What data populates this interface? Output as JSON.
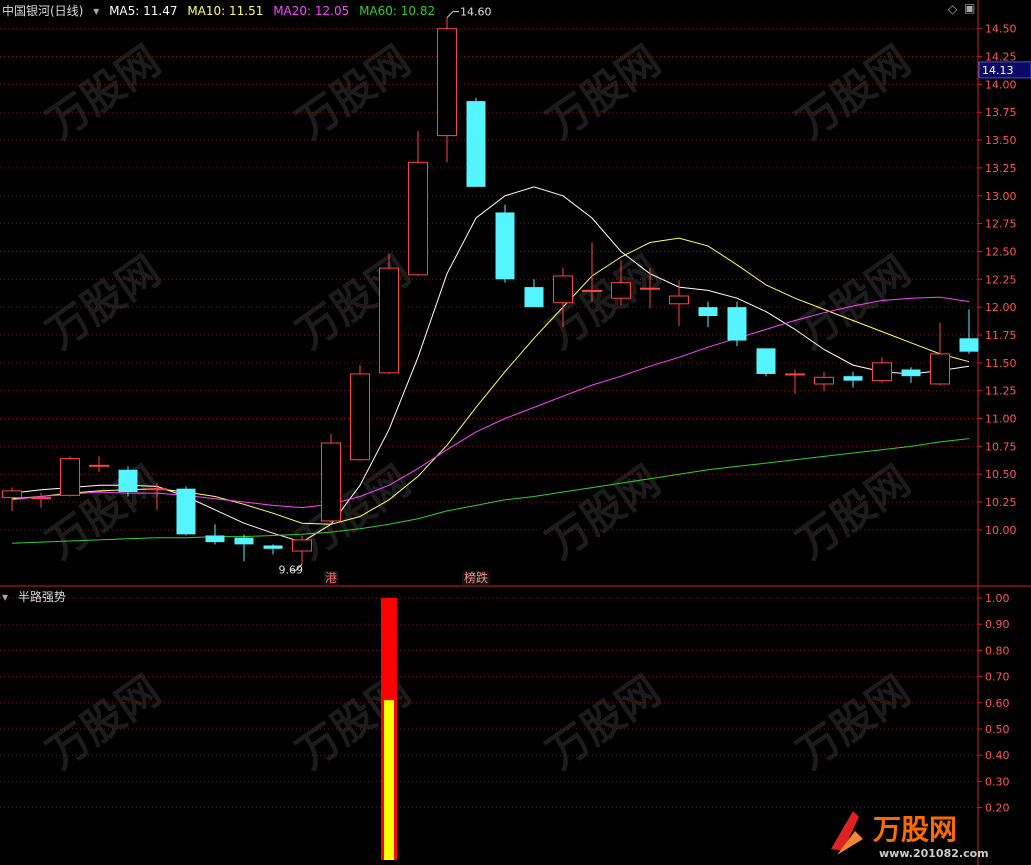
{
  "header": {
    "title": "中国银河(日线)",
    "ma_labels": [
      {
        "text": "MA5: 11.47",
        "color": "#ffffff"
      },
      {
        "text": "MA10: 11.51",
        "color": "#ffff66"
      },
      {
        "text": "MA20: 12.05",
        "color": "#ff44ff"
      },
      {
        "text": "MA60: 10.82",
        "color": "#33cc33"
      }
    ]
  },
  "indicator": {
    "title": "半路强势"
  },
  "colors": {
    "up": "#ff4444",
    "down": "#55f5ff",
    "grid": "#7a1a1a",
    "axis": "#cc2222",
    "ma5": "#ffffff",
    "ma10": "#ffff66",
    "ma20": "#ff44ff",
    "ma60": "#33cc33",
    "price_tag_bg": "#0a0a66"
  },
  "logo": {
    "text": "万股网",
    "url": "www.201082.com"
  },
  "chart_data": [
    {
      "type": "candlestick",
      "title": "中国银河(日线)",
      "ylim": [
        9.55,
        14.65
      ],
      "y_ticks": [
        "14.50",
        "14.25",
        "14.00",
        "13.75",
        "13.50",
        "13.25",
        "13.00",
        "12.75",
        "12.50",
        "12.25",
        "12.00",
        "11.75",
        "11.50",
        "11.25",
        "11.00",
        "10.75",
        "10.50",
        "10.25",
        "10.00"
      ],
      "current_price": "14.13",
      "annotations": {
        "high": "14.60",
        "low": "9.69",
        "events": [
          {
            "text": "港",
            "index": 11
          },
          {
            "text": "榜跌",
            "index": 16
          }
        ]
      },
      "candles": [
        {
          "o": 10.29,
          "c": 10.35,
          "h": 10.38,
          "l": 10.17
        },
        {
          "o": 10.29,
          "c": 10.29,
          "h": 10.33,
          "l": 10.2
        },
        {
          "o": 10.31,
          "c": 10.64,
          "h": 10.66,
          "l": 10.3
        },
        {
          "o": 10.58,
          "c": 10.58,
          "h": 10.66,
          "l": 10.52
        },
        {
          "o": 10.54,
          "c": 10.34,
          "h": 10.57,
          "l": 10.3
        },
        {
          "o": 10.37,
          "c": 10.37,
          "h": 10.42,
          "l": 10.18
        },
        {
          "o": 10.37,
          "c": 9.96,
          "h": 10.39,
          "l": 9.95
        },
        {
          "o": 9.95,
          "c": 9.89,
          "h": 10.05,
          "l": 9.87
        },
        {
          "o": 9.93,
          "c": 9.87,
          "h": 9.96,
          "l": 9.72
        },
        {
          "o": 9.86,
          "c": 9.83,
          "h": 9.87,
          "l": 9.78
        },
        {
          "o": 9.81,
          "c": 9.91,
          "h": 9.95,
          "l": 9.69
        },
        {
          "o": 10.08,
          "c": 10.78,
          "h": 10.86,
          "l": 10.06
        },
        {
          "o": 10.63,
          "c": 11.4,
          "h": 11.48,
          "l": 10.62
        },
        {
          "o": 11.41,
          "c": 12.35,
          "h": 12.48,
          "l": 11.4
        },
        {
          "o": 12.29,
          "c": 13.3,
          "h": 13.58,
          "l": 12.28
        },
        {
          "o": 13.54,
          "c": 14.5,
          "h": 14.6,
          "l": 13.3
        },
        {
          "o": 13.85,
          "c": 13.08,
          "h": 13.88,
          "l": 13.08
        },
        {
          "o": 12.85,
          "c": 12.25,
          "h": 12.92,
          "l": 12.22
        },
        {
          "o": 12.18,
          "c": 12.0,
          "h": 12.25,
          "l": 12.0
        },
        {
          "o": 12.04,
          "c": 12.28,
          "h": 12.35,
          "l": 11.82
        },
        {
          "o": 12.15,
          "c": 12.15,
          "h": 12.58,
          "l": 12.05
        },
        {
          "o": 12.08,
          "c": 12.22,
          "h": 12.42,
          "l": 12.02
        },
        {
          "o": 12.17,
          "c": 12.17,
          "h": 12.35,
          "l": 11.99
        },
        {
          "o": 12.03,
          "c": 12.1,
          "h": 12.24,
          "l": 11.83
        },
        {
          "o": 12.0,
          "c": 11.92,
          "h": 12.05,
          "l": 11.82
        },
        {
          "o": 12.0,
          "c": 11.7,
          "h": 12.05,
          "l": 11.65
        },
        {
          "o": 11.63,
          "c": 11.4,
          "h": 11.63,
          "l": 11.38
        },
        {
          "o": 11.4,
          "c": 11.4,
          "h": 11.44,
          "l": 11.22
        },
        {
          "o": 11.31,
          "c": 11.37,
          "h": 11.42,
          "l": 11.25
        },
        {
          "o": 11.38,
          "c": 11.34,
          "h": 11.42,
          "l": 11.28
        },
        {
          "o": 11.34,
          "c": 11.5,
          "h": 11.55,
          "l": 11.32
        },
        {
          "o": 11.44,
          "c": 11.38,
          "h": 11.46,
          "l": 11.32
        },
        {
          "o": 11.31,
          "c": 11.58,
          "h": 11.86,
          "l": 11.3
        },
        {
          "o": 11.72,
          "c": 11.6,
          "h": 11.98,
          "l": 11.58
        }
      ],
      "series": [
        {
          "name": "MA5",
          "values": [
            10.33,
            10.36,
            10.38,
            10.4,
            10.4,
            10.39,
            10.3,
            10.18,
            10.06,
            9.97,
            9.89,
            10.05,
            10.4,
            10.9,
            11.55,
            12.3,
            12.8,
            13.0,
            13.08,
            13.0,
            12.8,
            12.5,
            12.3,
            12.18,
            12.15,
            12.08,
            11.96,
            11.8,
            11.62,
            11.48,
            11.42,
            11.4,
            11.43,
            11.47
          ]
        },
        {
          "name": "MA10",
          "values": [
            10.28,
            10.3,
            10.33,
            10.35,
            10.36,
            10.37,
            10.34,
            10.3,
            10.23,
            10.15,
            10.06,
            10.05,
            10.12,
            10.27,
            10.48,
            10.76,
            11.1,
            11.42,
            11.72,
            12.0,
            12.28,
            12.45,
            12.58,
            12.62,
            12.55,
            12.38,
            12.2,
            12.08,
            11.98,
            11.88,
            11.78,
            11.68,
            11.58,
            11.51
          ]
        },
        {
          "name": "MA20",
          "values": [
            10.27,
            10.3,
            10.32,
            10.34,
            10.33,
            10.33,
            10.31,
            10.28,
            10.25,
            10.22,
            10.2,
            10.23,
            10.3,
            10.4,
            10.55,
            10.72,
            10.88,
            11.0,
            11.1,
            11.2,
            11.3,
            11.38,
            11.47,
            11.55,
            11.64,
            11.72,
            11.8,
            11.88,
            11.95,
            12.01,
            12.06,
            12.08,
            12.09,
            12.05
          ]
        },
        {
          "name": "MA60",
          "values": [
            9.88,
            9.89,
            9.9,
            9.91,
            9.92,
            9.93,
            9.93,
            9.94,
            9.94,
            9.95,
            9.96,
            9.98,
            10.01,
            10.05,
            10.1,
            10.17,
            10.22,
            10.27,
            10.3,
            10.34,
            10.38,
            10.42,
            10.46,
            10.5,
            10.54,
            10.57,
            10.6,
            10.63,
            10.66,
            10.69,
            10.72,
            10.75,
            10.79,
            10.82
          ]
        }
      ]
    },
    {
      "type": "bar",
      "title": "半路强势",
      "ylim": [
        0,
        1.0
      ],
      "y_ticks": [
        "1.00",
        "0.90",
        "0.80",
        "0.70",
        "0.60",
        "0.50",
        "0.40",
        "0.30",
        "0.20"
      ],
      "bars": [
        {
          "index": 13,
          "value": 1.0,
          "color": "#ff0000"
        },
        {
          "index": 13,
          "value": 0.61,
          "color": "#ffff00"
        }
      ]
    }
  ]
}
